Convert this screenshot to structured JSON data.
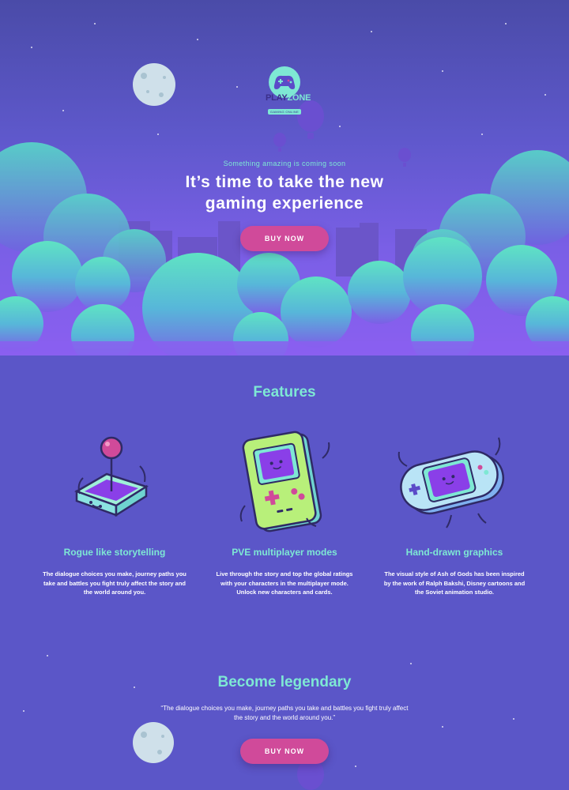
{
  "brand": {
    "logo_text_a": "PLAY",
    "logo_text_b": "ZONE",
    "logo_subtitle": "GAMING ONLINE"
  },
  "hero": {
    "tagline": "Something amazing is coming soon",
    "headline_line1": "It’s time to take the new",
    "headline_line2": "gaming experience",
    "cta_label": "BUY NOW"
  },
  "features": {
    "title": "Features",
    "items": [
      {
        "icon": "arcade-joystick-icon",
        "title": "Rogue like storytelling",
        "description": "The dialogue choices you make, journey paths you take and battles you fight truly affect the story and the world around you."
      },
      {
        "icon": "handheld-console-icon",
        "title": "PVE multiplayer modes",
        "description": "Live through the story and top the global ratings with your characters in the multiplayer mode. Unlock new characters and cards."
      },
      {
        "icon": "portable-gamepad-icon",
        "title": "Hand-drawn graphics",
        "description": "The visual style of Ash of Gods has been inspired by the work of Ralph Bakshi, Disney cartoons and the Soviet animation studio."
      }
    ]
  },
  "legendary": {
    "title": "Become legendary",
    "quote": "“The dialogue choices you make, journey paths you take and battles you fight truly affect the story and the world around you.”",
    "cta_label": "BUY NOW"
  },
  "colors": {
    "accent": "#7ee8d4",
    "button": "#d04a9a",
    "background": "#5b56c8"
  }
}
